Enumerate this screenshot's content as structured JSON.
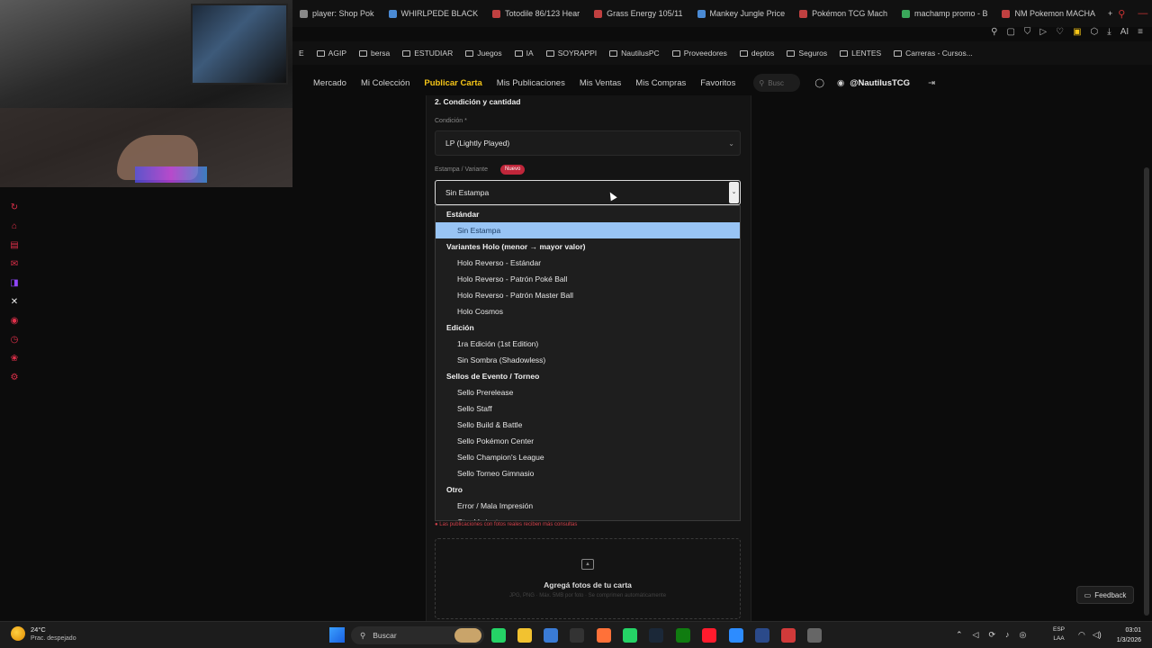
{
  "browser": {
    "tabs": [
      {
        "label": "player: Shop Pok",
        "color": "#888888"
      },
      {
        "label": "WHIRLPEDE BLACK",
        "color": "#4a8ad4"
      },
      {
        "label": "Totodile 86/123 Hear",
        "color": "#c04040"
      },
      {
        "label": "Grass Energy 105/11",
        "color": "#c04040"
      },
      {
        "label": "Mankey Jungle Price",
        "color": "#4a8ad4"
      },
      {
        "label": "Pokémon TCG Mach",
        "color": "#c04040"
      },
      {
        "label": "machamp promo - B",
        "color": "#3aa85a"
      },
      {
        "label": "NM Pokemon MACHA",
        "color": "#c04040"
      }
    ],
    "new_tab": "+",
    "bookmarks": [
      "E",
      "AGIP",
      "bersa",
      "ESTUDIAR",
      "Juegos",
      "IA",
      "SOYRAPPI",
      "NautilusPC",
      "Proveedores",
      "deptos",
      "Seguros",
      "LENTES",
      "Carreras - Cursos..."
    ],
    "ai_label": "AI"
  },
  "site": {
    "nav": [
      "Mercado",
      "Mi Colección",
      "Publicar Carta",
      "Mis Publicaciones",
      "Mis Ventas",
      "Mis Compras",
      "Favoritos"
    ],
    "active_nav": "Publicar Carta",
    "search_placeholder": "Busc",
    "username": "@NautilusTCG"
  },
  "form": {
    "section_title": "2. Condición y cantidad",
    "condition_label": "Condición *",
    "condition_value": "LP (Lightly Played)",
    "variant_label": "Estampa / Variante",
    "new_badge": "Nuevo",
    "variant_value": "Sin Estampa",
    "photo_note": "Las publicaciones con fotos reales reciben más consultas",
    "upload_title": "Agregá fotos de tu carta",
    "upload_sub": "JPG, PNG · Máx. 5MB por foto · Se comprimen automáticamente"
  },
  "dropdown": {
    "groups": [
      {
        "title": "Estándar",
        "options": [
          "Sin Estampa"
        ]
      },
      {
        "title": "Variantes Holo (menor → mayor valor)",
        "options": [
          "Holo Reverso - Estándar",
          "Holo Reverso - Patrón Poké Ball",
          "Holo Reverso - Patrón Master Ball",
          "Holo Cosmos"
        ]
      },
      {
        "title": "Edición",
        "options": [
          "1ra Edición (1st Edition)",
          "Sin Sombra (Shadowless)"
        ]
      },
      {
        "title": "Sellos de Evento / Torneo",
        "options": [
          "Sello Prerelease",
          "Sello Staff",
          "Sello Build & Battle",
          "Sello Pokémon Center",
          "Sello Champion's League",
          "Sello Torneo Gimnasio"
        ]
      },
      {
        "title": "Otro",
        "options": [
          "Error / Mala Impresión",
          "Otra Variante"
        ]
      }
    ],
    "selected": "Sin Estampa"
  },
  "feedback": "Feedback",
  "taskbar": {
    "weather_temp": "24°C",
    "weather_desc": "Prac. despejado",
    "search": "Buscar",
    "lang_top": "ESP",
    "lang_bottom": "LAA",
    "time": "03:01",
    "date": "1/3/2026"
  },
  "colors": {
    "accent": "#f5c518",
    "badge": "#c0263a",
    "selected_option": "#98c4f4"
  }
}
